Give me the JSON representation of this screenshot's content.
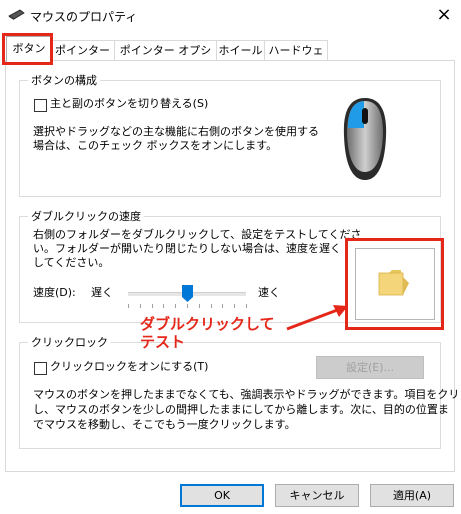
{
  "window": {
    "title": "マウスのプロパティ",
    "close_glyph": "×"
  },
  "tabs": [
    {
      "label": "ボタン",
      "active": true
    },
    {
      "label": "ポインター",
      "active": false
    },
    {
      "label": "ポインター オプション",
      "active": false
    },
    {
      "label": "ホイール",
      "active": false
    },
    {
      "label": "ハードウェア",
      "active": false
    }
  ],
  "button_config": {
    "legend": "ボタンの構成",
    "switch_checkbox_label": "主と副のボタンを切り替える(S)",
    "switch_checked": false,
    "desc_line1": "選択やドラッグなどの主な機能に右側のボタンを使用する",
    "desc_line2": "場合は、このチェック ボックスをオンにします。"
  },
  "double_click": {
    "legend": "ダブルクリックの速度",
    "desc_line1": "右側のフォルダーをダブルクリックして、設定をテストしてくださ",
    "desc_line2": "い。フォルダーが開いたり閉じたりしない場合は、速度を遅く",
    "desc_line3": "してください。",
    "speed_label": "速度(D):",
    "slow_label": "遅く",
    "fast_label": "速く",
    "speed_value_fraction": 0.5
  },
  "click_lock": {
    "legend": "クリックロック",
    "checkbox_label": "クリックロックをオンにする(T)",
    "checked": false,
    "settings_button": "設定(E)...",
    "desc_line1": "マウスのボタンを押したままでなくても、強調表示やドラッグができます。項目をクリック",
    "desc_line2": "し、マウスのボタンを少しの間押したままにしてから離します。次に、目的の位置ま",
    "desc_line3": "でマウスを移動し、そこでもう一度クリックします。"
  },
  "footer": {
    "ok": "OK",
    "cancel": "キャンセル",
    "apply": "適用(A)"
  },
  "annotation": {
    "line1": "ダブルクリックして",
    "line2": "テスト"
  },
  "icons": {
    "window_icon": "mouse-icon",
    "mouse_illustration": "mouse-illustration-icon",
    "folder": "folder-icon"
  },
  "colors": {
    "annotation_red": "#e5271a",
    "accent_blue": "#0078d7",
    "slider_blue": "#0078d7"
  }
}
